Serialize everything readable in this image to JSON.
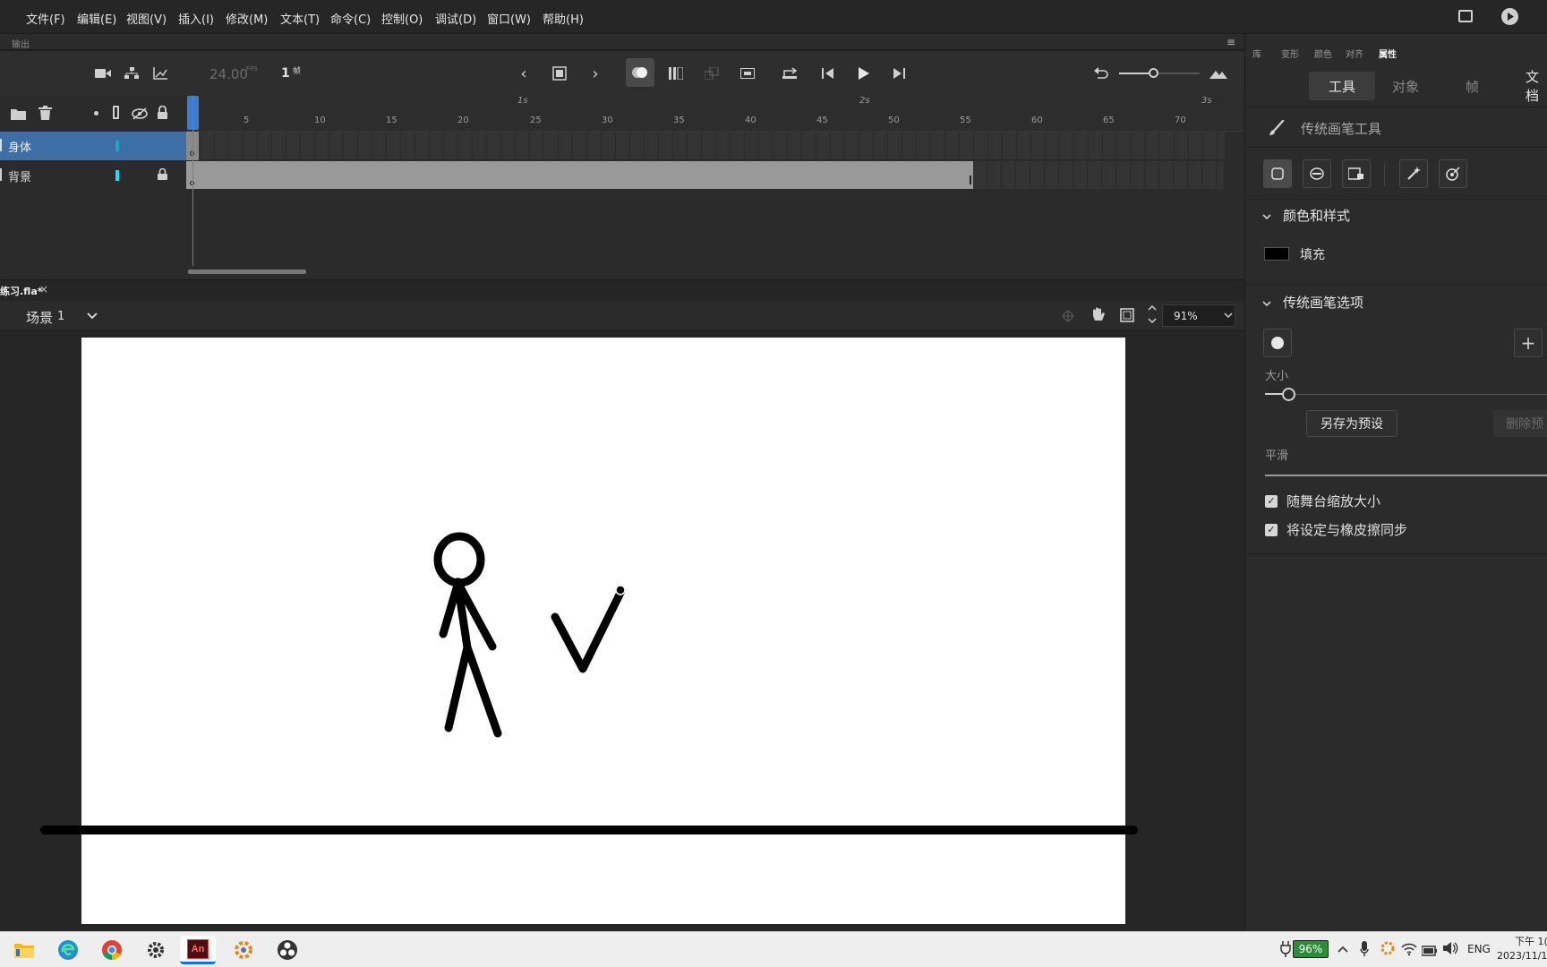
{
  "menu": [
    "文件(F)",
    "编辑(E)",
    "视图(V)",
    "插入(I)",
    "修改(M)",
    "文本(T)",
    "命令(C)",
    "控制(O)",
    "调试(D)",
    "窗口(W)",
    "帮助(H)"
  ],
  "panel_label": "输出",
  "timeline": {
    "fps": "24.00",
    "fps_unit": "FPS",
    "frame": "1",
    "frame_unit": "帧",
    "ticks": [
      "5",
      "10",
      "15",
      "20",
      "25",
      "30",
      "35",
      "40",
      "45",
      "50",
      "55",
      "60",
      "65",
      "70"
    ],
    "seconds": [
      "1s",
      "2s",
      "3s"
    ],
    "layers": [
      {
        "name": "身体"
      },
      {
        "name": "背景"
      }
    ]
  },
  "doc": {
    "tab": "练习.fla*",
    "close": "×",
    "scene_label": "场景",
    "scene_num": "1",
    "zoom": "91%"
  },
  "right_panel": {
    "tabs": [
      "库",
      "变形",
      "颜色",
      "对齐",
      "属性"
    ],
    "subtabs": [
      "工具",
      "对象",
      "帧",
      "文档"
    ],
    "tool_title": "传统画笔工具",
    "section_color": "颜色和样式",
    "fill_label": "填充",
    "section_brush": "传统画笔选项",
    "size_label": "大小",
    "save_preset": "另存为预设",
    "delete_preset": "删除预",
    "smooth_label": "平滑",
    "check1": "随舞台缩放大小",
    "check2": "将设定与橡皮擦同步",
    "plus": "+"
  },
  "taskbar": {
    "battery": "96%",
    "lang": "ENG",
    "time": "下午 1(",
    "date": "2023/11/1"
  },
  "colors": {
    "accent": "#3b7bd0",
    "layer_selected": "#3d6fa6",
    "fill_swatch": "#000000",
    "battery": "#2e8b3a"
  }
}
